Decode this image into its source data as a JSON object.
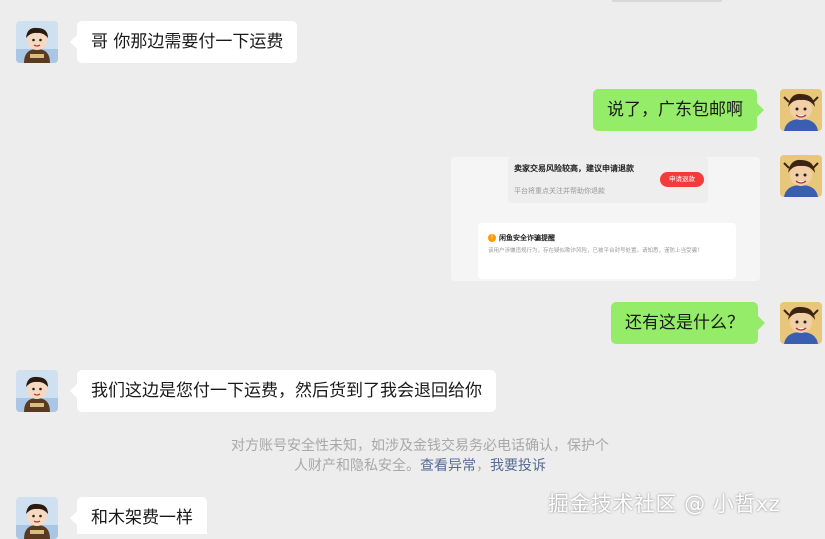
{
  "messages": [
    {
      "side": "in",
      "text": "哥 你那边需要付一下运费"
    },
    {
      "side": "out",
      "text": "说了，广东包邮啊"
    },
    {
      "side": "out",
      "type": "image"
    },
    {
      "side": "out",
      "text": "还有这是什么？"
    },
    {
      "side": "in",
      "text": "我们这边是您付一下运费，然后货到了我会退回给你"
    },
    {
      "side": "in",
      "text": "和木架费一样"
    }
  ],
  "image_card": {
    "title": "卖家交易风险较高，建议申请退款",
    "subtitle": "平台将重点关注并帮助你退款",
    "button": "申请退款",
    "warning_icon": "!",
    "warning_title": "闲鱼安全诈骗提醒",
    "warning_body": "该用户涉嫌违规行为，存在疑似欺诈风险，已被平台封号处置。请知悉，谨防上当受骗！"
  },
  "notice": {
    "line1": "对方账号安全性未知，如涉及金钱交易务必电话确认，保护个",
    "line2": "人财产和隐私安全。",
    "link1": "查看异常",
    "separator": "，",
    "link2": "我要投诉"
  },
  "watermark": "掘金技术社区 @ 小哲xz",
  "colors": {
    "background": "#ededed",
    "incoming": "#ffffff",
    "outgoing": "#95ec69",
    "link": "#576b95"
  }
}
